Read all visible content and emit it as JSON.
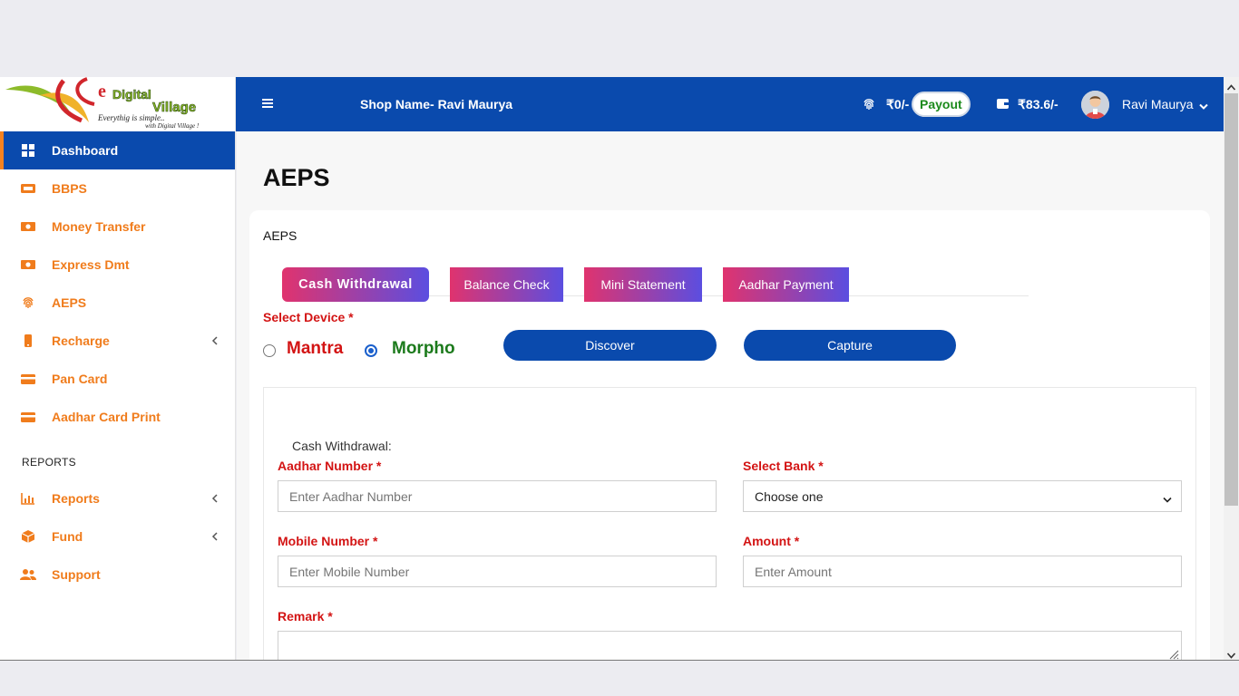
{
  "brand": {
    "logo_text_big": "Digital Village",
    "logo_tagline": "Everythig is simple..",
    "logo_tagline2": "with Digital Village !"
  },
  "sidebar": {
    "items": [
      {
        "label": "Dashboard",
        "icon": "dashboard-grid-icon",
        "active": true
      },
      {
        "label": "BBPS",
        "icon": "bill-icon"
      },
      {
        "label": "Money Transfer",
        "icon": "money-icon"
      },
      {
        "label": "Express Dmt",
        "icon": "money-icon"
      },
      {
        "label": "AEPS",
        "icon": "fingerprint-icon"
      },
      {
        "label": "Recharge",
        "icon": "mobile-icon",
        "has_submenu": true
      },
      {
        "label": "Pan Card",
        "icon": "card-icon"
      },
      {
        "label": "Aadhar Card Print",
        "icon": "card-icon"
      }
    ],
    "section_reports": "REPORTS",
    "report_items": [
      {
        "label": "Reports",
        "icon": "chart-icon",
        "has_submenu": true
      },
      {
        "label": "Fund",
        "icon": "box-icon",
        "has_submenu": true
      },
      {
        "label": "Support",
        "icon": "users-icon"
      }
    ]
  },
  "topbar": {
    "shop_name": "Shop Name- Ravi Maurya",
    "balance_aeps": "₹0/-",
    "payout_label": "Payout",
    "balance_wallet": "₹83.6/-",
    "user_name": "Ravi Maurya"
  },
  "main": {
    "page_title": "AEPS",
    "card_title": "AEPS",
    "tabs": [
      {
        "label": "Cash Withdrawal",
        "active": true
      },
      {
        "label": "Balance Check"
      },
      {
        "label": "Mini Statement"
      },
      {
        "label": "Aadhar Payment"
      }
    ],
    "select_device_label": "Select Device *",
    "devices": [
      {
        "label": "Mantra",
        "color": "#d31414",
        "checked": false
      },
      {
        "label": "Morpho",
        "color": "#1c7a1c",
        "checked": true
      }
    ],
    "discover_label": "Discover",
    "capture_label": "Capture",
    "form": {
      "heading": "Cash Withdrawal:",
      "aadhar_label": "Aadhar Number *",
      "aadhar_placeholder": "Enter Aadhar Number",
      "bank_label": "Select Bank *",
      "bank_value": "Choose one",
      "mobile_label": "Mobile Number *",
      "mobile_placeholder": "Enter Mobile Number",
      "amount_label": "Amount *",
      "amount_placeholder": "Enter Amount",
      "remark_label": "Remark *"
    }
  },
  "colors": {
    "primary": "#0a4aad",
    "accent_orange": "#f07c1c",
    "required_red": "#d31414",
    "tab_gradient_start": "#e0336e",
    "tab_gradient_end": "#5b4ee0"
  }
}
